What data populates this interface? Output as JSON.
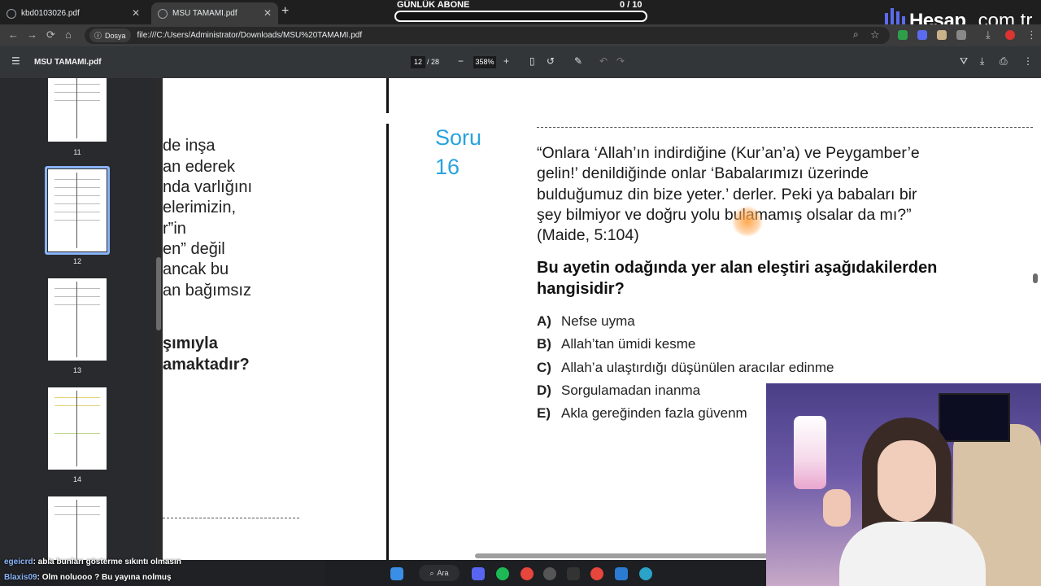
{
  "browser": {
    "tabs": [
      {
        "label": "kbd0103026.pdf",
        "active": false
      },
      {
        "label": "MSU TAMAMI.pdf",
        "active": true
      }
    ],
    "address": {
      "site_chip": "Dosya",
      "url": "file:///C:/Users/Administrator/Downloads/MSU%20TAMAMI.pdf"
    }
  },
  "overlay": {
    "subscriber_goal": {
      "label": "GÜNLÜK ABONE",
      "count": "0 / 10",
      "progress": 0
    },
    "logo": {
      "brand": "Hesap",
      "suffix": ".com.tr"
    },
    "chat": [
      {
        "user": "egeicrd",
        "message": ": abla bunları gösterme sıkıntı olmasın"
      },
      {
        "user": "Blaxis09",
        "message": ": Olm noluooo ? Bu yayına nolmuş"
      }
    ]
  },
  "pdf_toolbar": {
    "title": "MSU TAMAMI.pdf",
    "current_page": "12",
    "total_pages": "/ 28",
    "zoom": "358%"
  },
  "sidebar": {
    "thumbnails": [
      {
        "page": "11"
      },
      {
        "page": "12",
        "selected": true
      },
      {
        "page": "13"
      },
      {
        "page": "14"
      },
      {
        "page": ""
      }
    ]
  },
  "document": {
    "left_column_fragments": [
      "de inşa",
      "an ederek",
      "nda varlığını",
      "elerimizin,",
      "r”in",
      "en” değil",
      " ancak bu",
      "an bağımsız"
    ],
    "left_column_bold": [
      "şımıyla",
      "amaktadır?"
    ],
    "question": {
      "label": "Soru",
      "number": "16",
      "quote_lines": [
        "“Onlara ‘Allah’ın indirdiğine (Kur’an’a) ve Peygamber’e",
        "gelin!’ denildiğinde onlar ‘Babalarımızı üzerinde",
        "bulduğumuz din bize yeter.’ derler. Peki ya babaları bir",
        "şey bilmiyor ve doğru yolu bulamamış olsalar da mı?”",
        "(Maide, 5:104)"
      ],
      "prompt_lines": [
        "Bu ayetin odağında yer alan eleştiri aşağıdakilerden",
        "hangisidir?"
      ],
      "options": [
        {
          "letter": "A)",
          "text": "Nefse uyma"
        },
        {
          "letter": "B)",
          "text": "Allah’tan ümidi kesme"
        },
        {
          "letter": "C)",
          "text": "Allah’a ulaştırdığı düşünülen aracılar edinme"
        },
        {
          "letter": "D)",
          "text": "Sorgulamadan inanma"
        },
        {
          "letter": "E)",
          "text": "Akla gereğinden fazla güvenm"
        }
      ]
    }
  },
  "taskbar": {
    "search_label": "Ara"
  },
  "colors": {
    "accent_blue": "#29a3de",
    "selection": "#8ab4f8",
    "toolbar": "#323639",
    "sidebar": "#292a2d"
  }
}
